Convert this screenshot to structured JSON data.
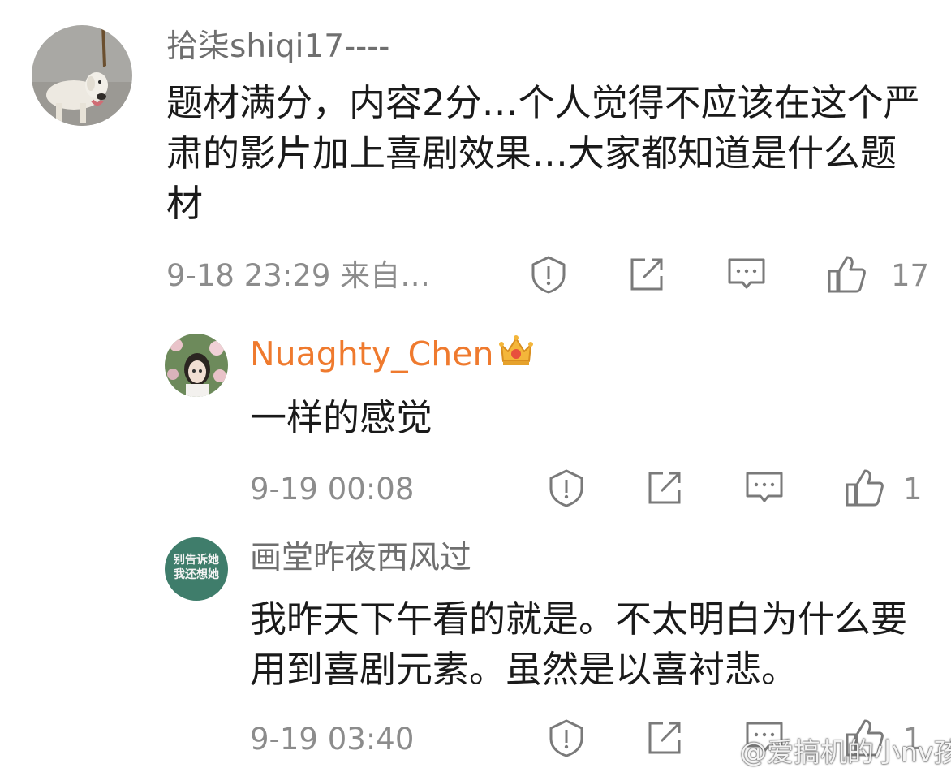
{
  "comments": [
    {
      "author": "拾柒shiqi17----",
      "text": "题材满分，内容2分…个人觉得不应该在这个严肃的影片加上喜剧效果…大家都知道是什么题材",
      "timestamp": "9-18 23:29  来自…",
      "likes": "17",
      "avatar_icon": "labrador-dog-photo"
    },
    {
      "author": "Nuaghty_Chen",
      "author_color": "#ef7a2e",
      "badge_icon": "crown-icon",
      "text": "一样的感觉",
      "timestamp": "9-19 00:08",
      "likes": "1",
      "avatar_icon": "girl-photo"
    },
    {
      "author": "画堂昨夜西风过",
      "text": "我昨天下午看的就是。不太明白为什么要用到喜剧元素。虽然是以喜衬悲。",
      "timestamp": "9-19 03:40",
      "likes": "1",
      "avatar_icon": "text-badge",
      "avatar_text": [
        "别告诉她",
        "我还想她"
      ]
    }
  ],
  "actions": [
    "report-icon",
    "repost-icon",
    "comment-icon",
    "like-icon"
  ],
  "watermark": "@爱搞机的小nv孩",
  "colors": {
    "text": "#1a1a1a",
    "meta": "#8c8c8c",
    "author": "#6f6f6f",
    "highlight_author": "#ef7a2e",
    "badge_avatar": "#3f7d6b"
  }
}
